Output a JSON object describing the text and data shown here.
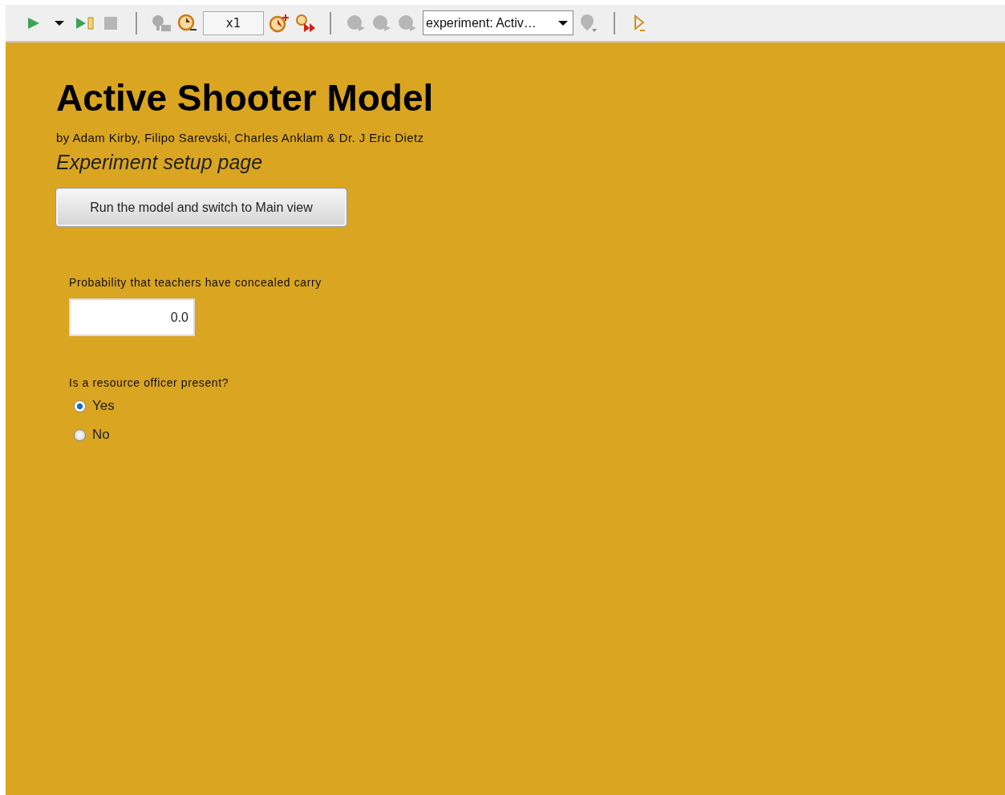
{
  "toolbar": {
    "items": [
      {
        "kind": "run",
        "disabled": false
      },
      {
        "kind": "caret",
        "disabled": false
      },
      {
        "kind": "step",
        "disabled": false
      },
      {
        "kind": "stop",
        "disabled": true
      },
      {
        "kind": "separator"
      },
      {
        "kind": "realtime",
        "disabled": true
      },
      {
        "kind": "slower",
        "disabled": false
      },
      {
        "kind": "speed",
        "value": "x1"
      },
      {
        "kind": "faster",
        "disabled": false
      },
      {
        "kind": "fastest",
        "disabled": false
      },
      {
        "kind": "separator"
      },
      {
        "kind": "bubble-x",
        "disabled": true
      },
      {
        "kind": "bubble-a",
        "disabled": true
      },
      {
        "kind": "bubble-stack",
        "disabled": true
      },
      {
        "kind": "select",
        "value": "experiment: Activ…"
      },
      {
        "kind": "pin",
        "disabled": true
      },
      {
        "kind": "separator"
      },
      {
        "kind": "launch",
        "disabled": false
      }
    ]
  },
  "page": {
    "title": "Active Shooter Model",
    "authors": "by Adam Kirby, Filipo Sarevski, Charles Anklam & Dr. J Eric Dietz",
    "subtitle": "Experiment setup page",
    "run_button": "Run the model and switch to Main view",
    "probability": {
      "label": "Probability that teachers have concealed carry",
      "value": "0.0"
    },
    "officer": {
      "label": "Is a resource officer present?",
      "options": [
        {
          "label": "Yes",
          "selected": true
        },
        {
          "label": "No",
          "selected": false
        }
      ]
    }
  }
}
